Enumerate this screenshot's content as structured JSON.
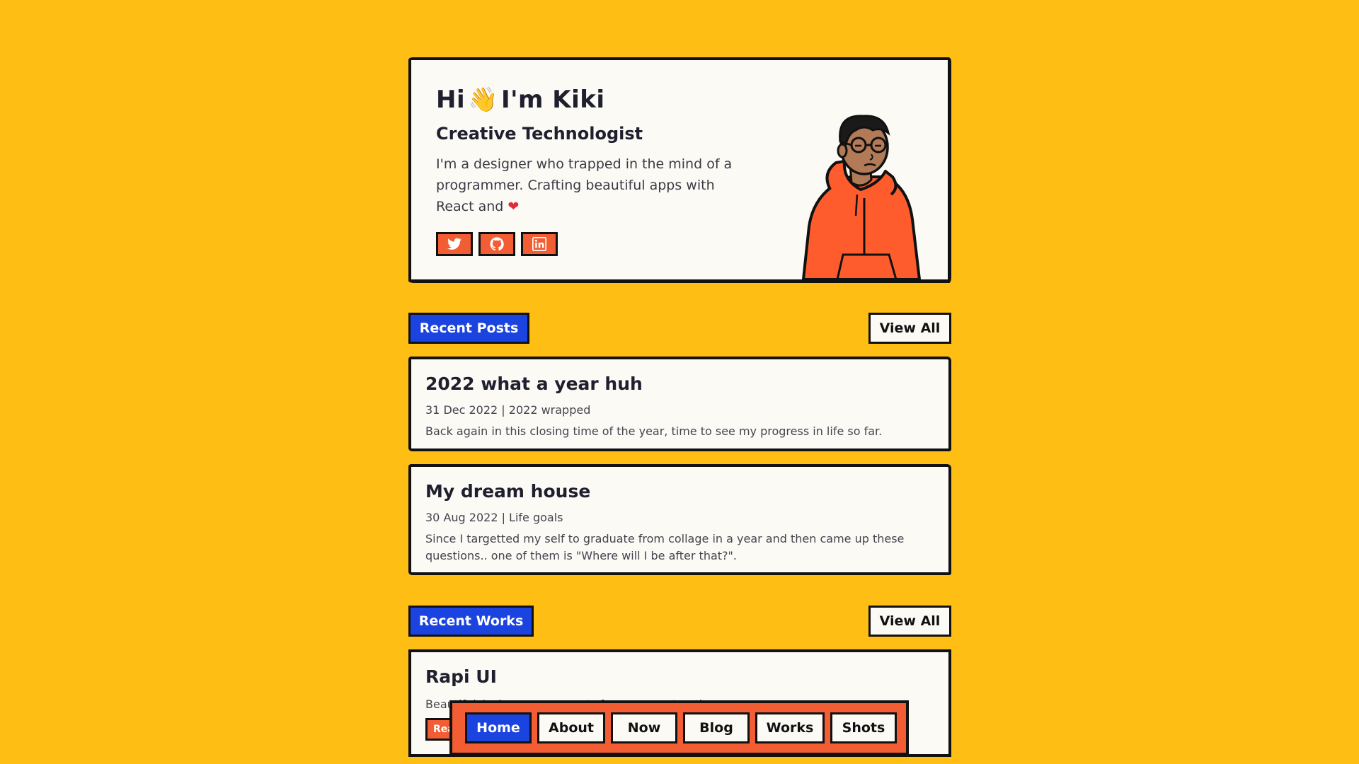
{
  "hero": {
    "title_hi": "Hi",
    "title_name": "I'm Kiki",
    "wave_emoji": "👋",
    "subtitle": "Creative Technologist",
    "description": "I'm a designer who trapped in the mind of a programmer. Crafting beautiful apps with React and",
    "heart": "❤",
    "socials": [
      {
        "icon": "twitter-icon"
      },
      {
        "icon": "github-icon"
      },
      {
        "icon": "linkedin-icon"
      }
    ]
  },
  "recent_posts": {
    "heading": "Recent Posts",
    "view_all": "View All",
    "posts": [
      {
        "title": "2022 what a year huh",
        "meta": "31 Dec 2022 | 2022 wrapped",
        "excerpt": "Back again in this closing time of the year, time to see my progress in life so far."
      },
      {
        "title": "My dream house",
        "meta": "30 Aug 2022 | Life goals",
        "excerpt": "Since I targetted my self to graduate from collage in a year and then came up these questions.. one of them is \"Where will I be after that?\"."
      }
    ]
  },
  "recent_works": {
    "heading": "Recent Works",
    "view_all": "View All",
    "works": [
      {
        "title": "Rapi UI",
        "excerpt": "Beautiful & clean components for your react native apps",
        "button": "Rea"
      }
    ]
  },
  "nav": {
    "items": [
      "Home",
      "About",
      "Now",
      "Blog",
      "Works",
      "Shots"
    ],
    "active": "Home"
  },
  "colors": {
    "background": "#FFBE13",
    "accent_blue": "#1B43E0",
    "accent_orange": "#F25D33",
    "card": "#FBFAF5"
  }
}
